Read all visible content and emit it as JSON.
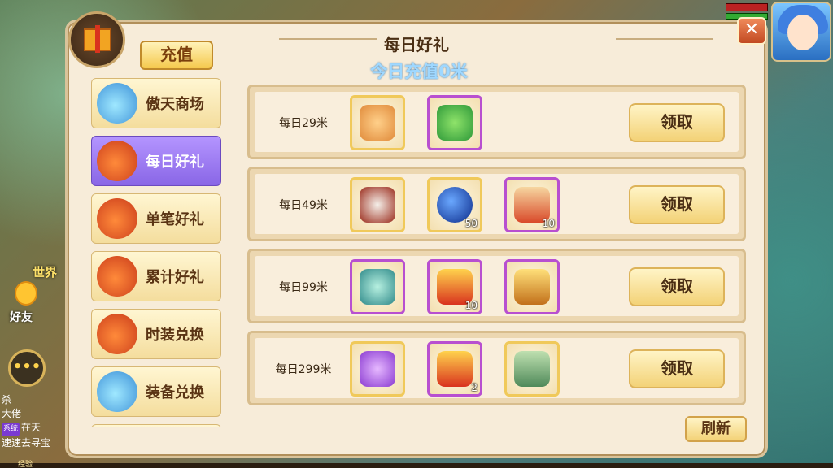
{
  "panel": {
    "title": "每日好礼",
    "recharge_label": "充值",
    "today_text": "今日充值0米",
    "refresh_label": "刷新",
    "close_label": "✕"
  },
  "sidebar": {
    "items": [
      {
        "label": "傲天商场",
        "icon": "blue-bag-icon",
        "active": false
      },
      {
        "label": "每日好礼",
        "icon": "gift-bag-icon",
        "active": true
      },
      {
        "label": "单笔好礼",
        "icon": "gift-bag-icon",
        "active": false
      },
      {
        "label": "累计好礼",
        "icon": "gift-bag-icon",
        "active": false
      },
      {
        "label": "时装兑换",
        "icon": "gift-bag-icon",
        "active": false
      },
      {
        "label": "装备兑换",
        "icon": "blue-bag-icon",
        "active": false
      }
    ]
  },
  "rewards": [
    {
      "amount": "每日29米",
      "claim_label": "领取",
      "items": [
        {
          "icon": "fox-pet-icon",
          "frame": "gold",
          "count": ""
        },
        {
          "icon": "green-jade-icon",
          "frame": "purple",
          "count": ""
        }
      ]
    },
    {
      "amount": "每日49米",
      "claim_label": "领取",
      "items": [
        {
          "icon": "mask-warrior-icon",
          "frame": "gold",
          "count": ""
        },
        {
          "icon": "blue-orb-icon",
          "frame": "gold",
          "count": "50"
        },
        {
          "icon": "red-talisman-icon",
          "frame": "purple",
          "count": "10"
        }
      ]
    },
    {
      "amount": "每日99米",
      "claim_label": "领取",
      "items": [
        {
          "icon": "armored-knight-icon",
          "frame": "purple",
          "count": ""
        },
        {
          "icon": "treasure-chest-icon",
          "frame": "purple",
          "count": "10"
        },
        {
          "icon": "golden-chest-icon",
          "frame": "purple",
          "count": ""
        }
      ]
    },
    {
      "amount": "每日299米",
      "claim_label": "领取",
      "items": [
        {
          "icon": "purple-dragon-icon",
          "frame": "gold",
          "count": ""
        },
        {
          "icon": "treasure-chest-icon",
          "frame": "purple",
          "count": "2"
        },
        {
          "icon": "green-book-icon",
          "frame": "gold",
          "count": ""
        }
      ]
    }
  ],
  "hud": {
    "world_label": "世界",
    "friend_label": "好友",
    "chat_icon_label": "•••",
    "chat_lines": [
      {
        "tag": "",
        "text": "杀"
      },
      {
        "tag": "",
        "text": "大佬"
      },
      {
        "tag": "系统",
        "text": "在天"
      },
      {
        "tag": "",
        "text": "速速去寻宝"
      }
    ],
    "exp_label": "经验"
  },
  "colors": {
    "panel_bg": "#f7ecd9",
    "active_tab": "#8966e6",
    "gold_frame": "#f0c95a",
    "purple_frame": "#b84fd0",
    "today_text": "#9fd8ff"
  }
}
